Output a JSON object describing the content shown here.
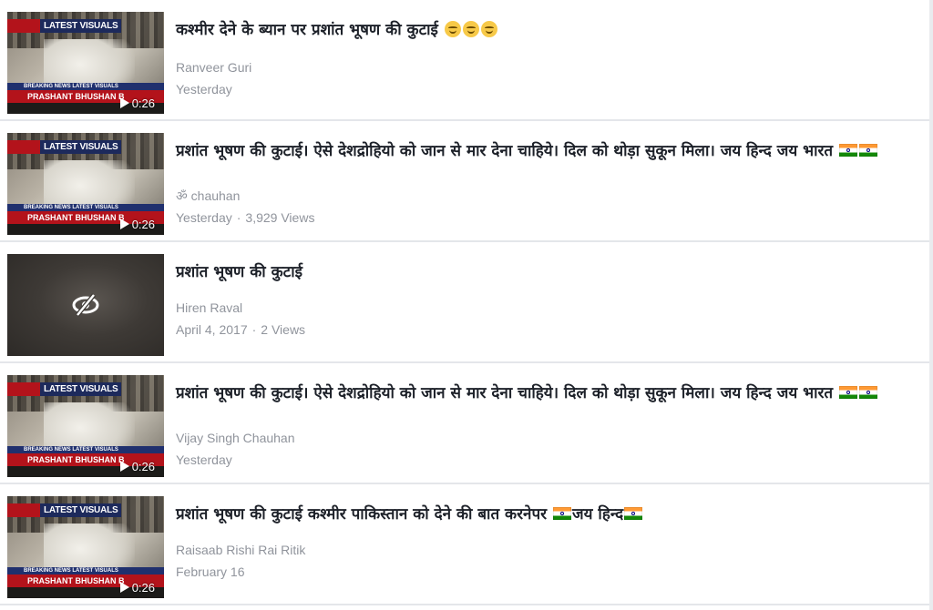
{
  "thumbnail": {
    "brand_text": "LATEST VISUALS",
    "band_text": "BREAKING NEWS       LATEST VISUALS",
    "nameplate_text": "PRASHANT BHUSHAN B"
  },
  "videos": [
    {
      "title": "कश्मीर देने के ब्यान पर प्रशांत भूषण की कुटाई",
      "emoji": [
        "smiling-face-emoji",
        "smiling-face-emoji",
        "smiling-face-emoji"
      ],
      "author": "Ranveer Guri",
      "date": "Yesterday",
      "views": "",
      "duration": "0:26"
    },
    {
      "title": "प्रशांत भूषण की कुटाई। ऐसे देशद्रोहियो को जान से मार देना चाहिये। दिल को थोड़ा सुकून मिला। जय हिन्द जय भारत",
      "emoji": [
        "india-flag-emoji",
        "india-flag-emoji"
      ],
      "author": "ॐ chauhan",
      "date": "Yesterday",
      "views": "3,929 Views",
      "duration": "0:26"
    },
    {
      "title": "प्रशांत भूषण की कुटाई",
      "emoji": [],
      "author": "Hiren Raval",
      "date": "April 4, 2017",
      "views": "2 Views",
      "duration": ""
    },
    {
      "title": "प्रशांत भूषण की कुटाई। ऐसे देशद्रोहियो को जान से मार देना चाहिये। दिल को थोड़ा सुकून मिला। जय हिन्द जय भारत",
      "emoji": [
        "india-flag-emoji",
        "india-flag-emoji"
      ],
      "author": "Vijay Singh Chauhan",
      "date": "Yesterday",
      "views": "",
      "duration": "0:26"
    },
    {
      "title_part1": "प्रशांत भूषण की कुटाई कश्मीर पाकिस्तान को देने की बात करनेपर",
      "title_part2": "जय हिन्द",
      "emoji": [
        "india-flag-emoji",
        "india-flag-emoji"
      ],
      "author": "Raisaab Rishi Rai Ritik",
      "date": "February 16",
      "views": "",
      "duration": "0:26"
    }
  ],
  "separator": "·"
}
